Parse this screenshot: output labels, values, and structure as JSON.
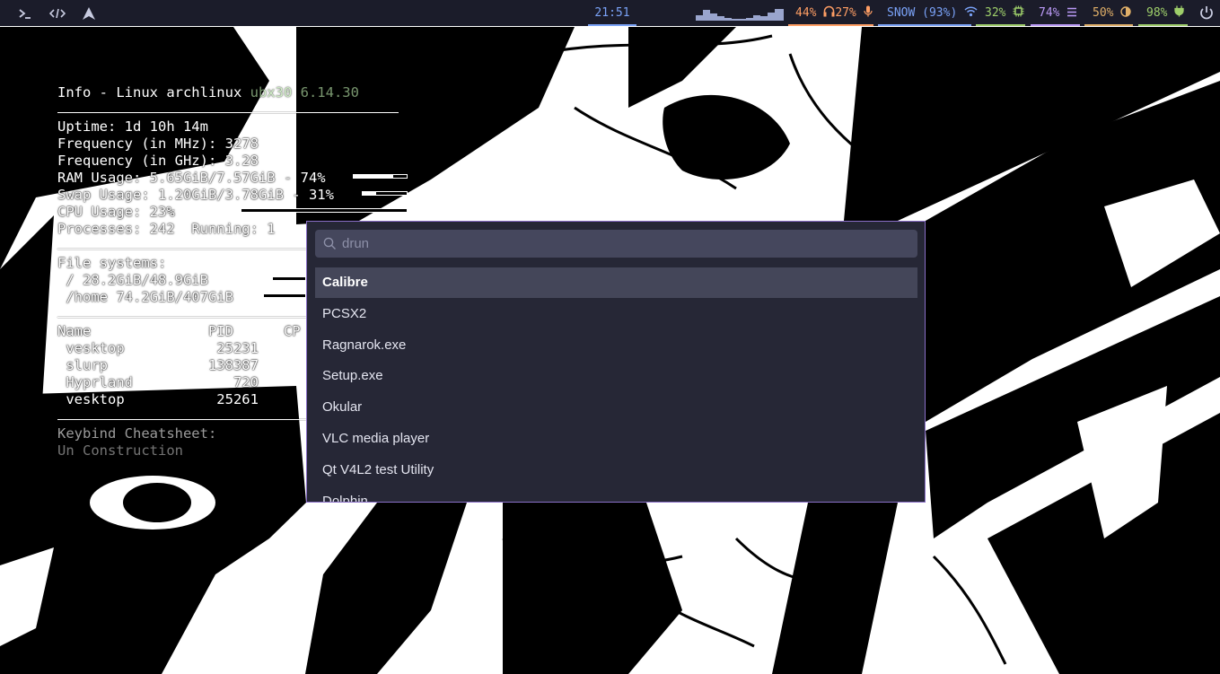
{
  "topbar": {
    "left_icons": [
      "terminal-icon",
      "code-icon",
      "arch-logo-icon"
    ],
    "clock": "21:51",
    "audio": {
      "volume": "44%",
      "headphone": "27%",
      "icons": [
        "headphones-icon",
        "microphone-icon"
      ]
    },
    "wifi": {
      "label": "SNOW (93%)",
      "icon": "wifi-icon"
    },
    "cpu": {
      "value": "32%",
      "icon": "chip-icon"
    },
    "memory": {
      "value": "74%",
      "icon": "memory-icon"
    },
    "brightness": {
      "value": "50%",
      "icon": "brightness-icon"
    },
    "battery": {
      "value": "98%",
      "icon": "plug-icon"
    },
    "power_icon": "power-icon",
    "colors": {
      "background": "#1b1c2a",
      "clock": "#7aa2f7",
      "audio": "#ff9e64",
      "wifi": "#7aa2f7",
      "cpu": "#9ece6a",
      "memory": "#bb9af7",
      "brightness": "#e0af68",
      "battery": "#9ece6a"
    }
  },
  "conky": {
    "title": "Info - Linux archlinux",
    "title_faded": " ubx30 6.14.30",
    "uptime": "Uptime: 1d 10h 14m",
    "freq_mhz": "Frequency (in MHz): 3278",
    "freq_ghz": "Frequency (in GHz): 3.28",
    "ram": "RAM Usage: 5.65GiB/7.57GiB - 74%",
    "ram_pct": 74,
    "swap": "Swap Usage: 1.20GiB/3.78GiB - 31%",
    "swap_pct": 31,
    "cpu": "CPU Usage: 23%",
    "cpu_pct": 23,
    "processes": "Processes: 242  Running: 1",
    "fs_header": "File systems:",
    "fs_root": " / 28.2GiB/48.9GiB",
    "fs_root_pct": 58,
    "fs_home": " /home 74.2GiB/407GiB",
    "fs_home_pct": 18,
    "proc_header": "Name              PID      CP",
    "proc_rows": [
      " vesktop           25231",
      " slurp            138387",
      " Hyprland            720",
      " vesktop           25261"
    ],
    "keybind_header": "Keybind Cheatsheet:",
    "keybind_note": "Un Construction"
  },
  "launcher": {
    "search": {
      "placeholder": "drun",
      "value": ""
    },
    "results": [
      "Calibre",
      "PCSX2",
      "Ragnarok.exe",
      "Setup.exe",
      "Okular",
      "VLC media player",
      "Qt V4L2 test Utility",
      "Dolphin"
    ],
    "selected_index": 0,
    "colors": {
      "background": "#262736",
      "border": "#8a6fc8",
      "selected": "#444659",
      "search_box": "#45475d"
    }
  }
}
